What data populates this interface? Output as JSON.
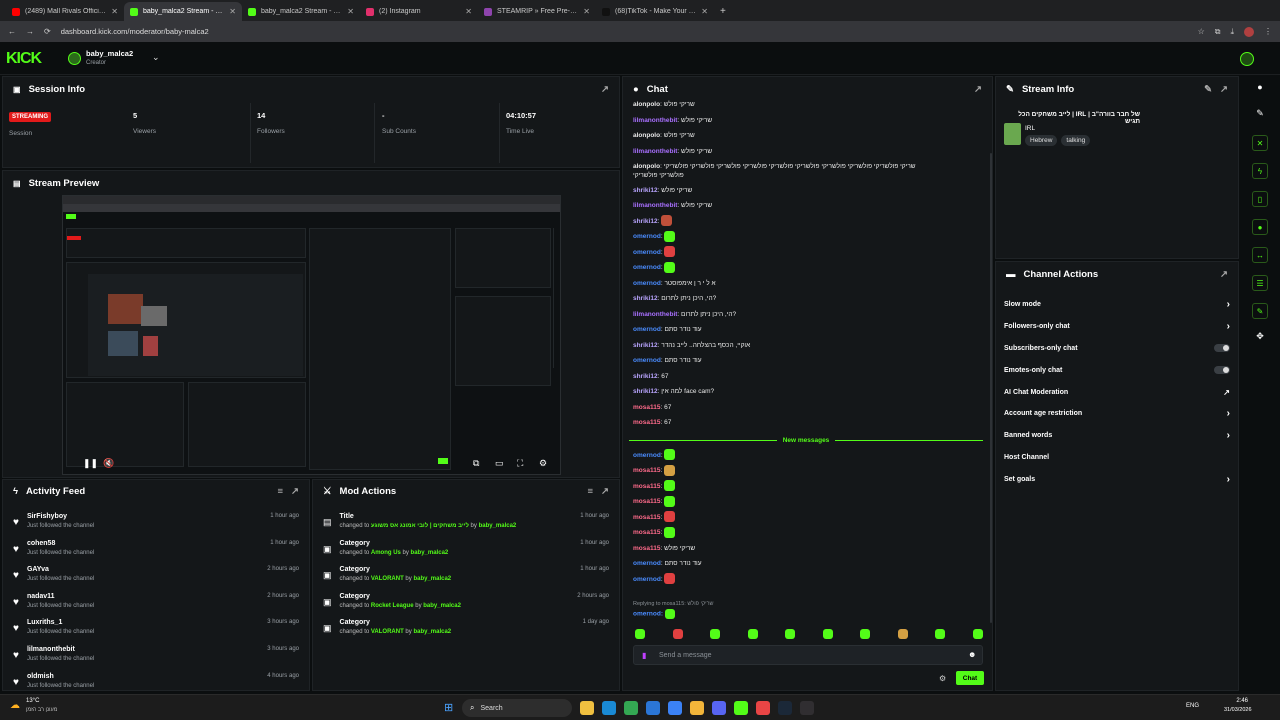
{
  "browser": {
    "tabs": [
      {
        "title": "(2489) Mall Rivals Official Demo",
        "color": "#ff0000"
      },
      {
        "title": "baby_malca2 Stream - Kick Das",
        "color": "#53fc18",
        "active": true
      },
      {
        "title": "baby_malca2 Stream - Watch L",
        "color": "#53fc18"
      },
      {
        "title": "(2) Instagram",
        "color": "#e1306c"
      },
      {
        "title": "STEAMRIP » Free Pre-installed",
        "color": "#8e44ad"
      },
      {
        "title": "(68)TikTok - Make Your Day",
        "color": "#111111"
      }
    ],
    "url": "dashboard.kick.com/moderator/baby-malca2"
  },
  "header": {
    "logo": "KICK",
    "channel_name": "baby_malca2",
    "role": "Creator"
  },
  "session_info": {
    "title": "Session Info",
    "badge": "STREAMING",
    "badge_label": "Session",
    "stats": [
      {
        "value": "5",
        "label": "Viewers"
      },
      {
        "value": "14",
        "label": "Followers"
      },
      {
        "value": "-",
        "label": "Sub Counts"
      },
      {
        "value": "04:10:57",
        "label": "Time Live"
      }
    ]
  },
  "stream_preview": {
    "title": "Stream Preview"
  },
  "activity_feed": {
    "title": "Activity Feed",
    "items": [
      {
        "name": "SirFishyboy",
        "sub": "Just followed the channel",
        "time": "1 hour ago"
      },
      {
        "name": "cohen58",
        "sub": "Just followed the channel",
        "time": "1 hour ago"
      },
      {
        "name": "GAYva",
        "sub": "Just followed the channel",
        "time": "2 hours ago"
      },
      {
        "name": "nadav11",
        "sub": "Just followed the channel",
        "time": "2 hours ago"
      },
      {
        "name": "Luxriths_1",
        "sub": "Just followed the channel",
        "time": "3 hours ago"
      },
      {
        "name": "lilmanonthebit",
        "sub": "Just followed the channel",
        "time": "3 hours ago"
      },
      {
        "name": "oldmish",
        "sub": "Just followed the channel",
        "time": "4 hours ago"
      }
    ]
  },
  "mod_actions": {
    "title": "Mod Actions",
    "items": [
      {
        "kind": "Title",
        "pre": "changed to ",
        "val": "לייב משחקים | לובי אמונג אס משוגע",
        "by": " by ",
        "user": "baby_malca2",
        "time": "1 hour ago"
      },
      {
        "kind": "Category",
        "pre": "changed to ",
        "val": "Among Us",
        "by": " by ",
        "user": "baby_malca2",
        "time": "1 hour ago"
      },
      {
        "kind": "Category",
        "pre": "changed to ",
        "val": "VALORANT",
        "by": " by ",
        "user": "baby_malca2",
        "time": "1 hour ago"
      },
      {
        "kind": "Category",
        "pre": "changed to ",
        "val": "Rocket League",
        "by": " by ",
        "user": "baby_malca2",
        "time": "2 hours ago"
      },
      {
        "kind": "Category",
        "pre": "changed to ",
        "val": "VALORANT",
        "by": " by ",
        "user": "baby_malca2",
        "time": "1 day ago"
      }
    ]
  },
  "chat": {
    "title": "Chat",
    "messages": [
      {
        "user": "alonpolo",
        "color": "#e8e8e8",
        "text": "שריקי פולש"
      },
      {
        "user": "lilmanonthebit",
        "color": "#a970ff",
        "text": "שריקי פולש"
      },
      {
        "user": "alonpolo",
        "color": "#e8e8e8",
        "text": "שריקי פולש"
      },
      {
        "user": "lilmanonthebit",
        "color": "#a970ff",
        "text": "שריקי פולש"
      },
      {
        "user": "alonpolo",
        "color": "#e8e8e8",
        "text": "שריקי פולשריקי פולשריקי פולשריקי פולשריקי פולשריקי פולשריקי פולשריקי פולשריקי פולשריקי",
        "text2": "פולשריקי פולשריקי"
      },
      {
        "user": "shriki12",
        "color": "#b9a5ff",
        "text": "שריקי פולש"
      },
      {
        "user": "lilmanonthebit",
        "color": "#a970ff",
        "text": "שריקי פולש"
      },
      {
        "user": "shriki12",
        "color": "#b9a5ff",
        "emote": "#c0503a"
      },
      {
        "user": "omernod",
        "color": "#4a8cff",
        "emote": "#53fc18"
      },
      {
        "user": "omernod",
        "color": "#4a8cff",
        "emote": "#e04040"
      },
      {
        "user": "omernod",
        "color": "#4a8cff",
        "emote": "#53fc18"
      },
      {
        "user": "omernod",
        "color": "#4a8cff",
        "text": "א ל י ר ן אימפוסטר"
      },
      {
        "user": "shriki12",
        "color": "#b9a5ff",
        "text": "הי, היכן ניתן לתרום?"
      },
      {
        "user": "lilmanonthebit",
        "color": "#a970ff",
        "text": "הי, היכן ניתן לתרום?"
      },
      {
        "user": "omernod",
        "color": "#4a8cff",
        "text": "עוד נודר סתם"
      },
      {
        "user": "shriki12",
        "color": "#b9a5ff",
        "text": "אוקיי, הכסף בהצלחה.. לייב נהדר"
      },
      {
        "user": "omernod",
        "color": "#4a8cff",
        "text": "עוד נודר סתם"
      },
      {
        "user": "shriki12",
        "color": "#b9a5ff",
        "text": "67"
      },
      {
        "user": "shriki12",
        "color": "#b9a5ff",
        "text": "למה אין face cam?"
      },
      {
        "user": "mosa115",
        "color": "#ff6b8b",
        "text": "67"
      },
      {
        "user": "mosa115",
        "color": "#ff6b8b",
        "text": "67"
      }
    ],
    "divider": "New messages",
    "messages2": [
      {
        "user": "omernod",
        "color": "#4a8cff",
        "emote": "#53fc18"
      },
      {
        "user": "mosa115",
        "color": "#ff6b8b",
        "emote": "#d4a043"
      },
      {
        "user": "mosa115",
        "color": "#ff6b8b",
        "emote": "#53fc18"
      },
      {
        "user": "mosa115",
        "color": "#ff6b8b",
        "emote": "#53fc18"
      },
      {
        "user": "mosa115",
        "color": "#ff6b8b",
        "emote": "#e04040"
      },
      {
        "user": "mosa115",
        "color": "#ff6b8b",
        "emote": "#53fc18"
      },
      {
        "user": "mosa115",
        "color": "#ff6b8b",
        "text": "שריקי פולש"
      },
      {
        "user": "omernod",
        "color": "#4a8cff",
        "text": "עוד נודר סתם"
      },
      {
        "user": "omernod",
        "color": "#4a8cff",
        "emote": "#e04040"
      }
    ],
    "reply_note": "Replying to mosa115: שריקי פולש",
    "last_user": "omernod",
    "input_placeholder": "Send a message",
    "send_label": "Chat"
  },
  "stream_info": {
    "title": "Stream Info",
    "stream_title": "של חבר בוורה\"ב | IRL | לייב משחקים הכל תגיש",
    "category": "IRL",
    "tags": [
      "Hebrew",
      "talking"
    ]
  },
  "channel_actions": {
    "title": "Channel Actions",
    "items": [
      {
        "label": "Slow mode",
        "control": "chevron"
      },
      {
        "label": "Followers-only chat",
        "control": "chevron"
      },
      {
        "label": "Subscribers-only chat",
        "control": "toggle"
      },
      {
        "label": "Emotes-only chat",
        "control": "toggle"
      },
      {
        "label": "AI Chat Moderation",
        "control": "external"
      },
      {
        "label": "Account age restriction",
        "control": "chevron"
      },
      {
        "label": "Banned words",
        "control": "chevron"
      },
      {
        "label": "Host Channel",
        "control": "none"
      },
      {
        "label": "Set goals",
        "control": "chevron"
      }
    ]
  },
  "taskbar": {
    "weather_temp": "13°C",
    "weather_desc": "מעונן רב הזמן",
    "search": "Search",
    "lang": "ENG",
    "time": "2:46",
    "date": "31/03/2026"
  }
}
